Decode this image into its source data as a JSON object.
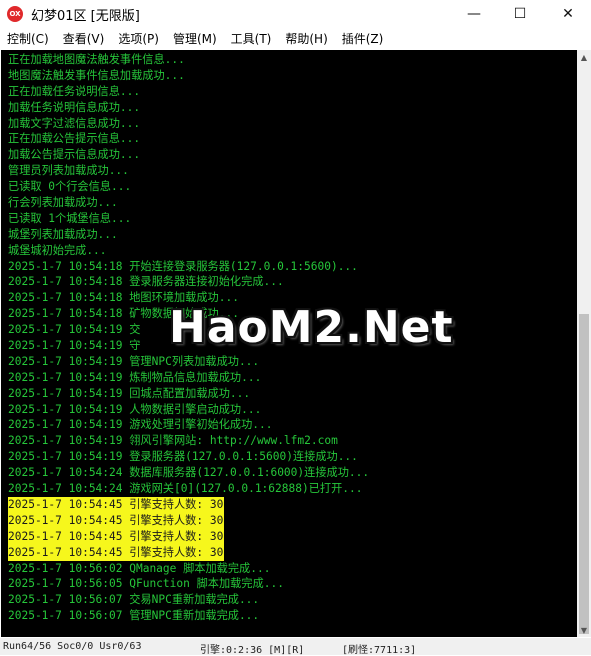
{
  "window": {
    "icon_text": "OX",
    "title": "幻梦01区 [无限版]",
    "controls": {
      "minimize": "—",
      "maximize": "☐",
      "close": "✕"
    }
  },
  "menu": [
    "控制(C)",
    "查看(V)",
    "选项(P)",
    "管理(M)",
    "工具(T)",
    "帮助(H)",
    "插件(Z)"
  ],
  "console": {
    "lines": [
      {
        "text": "正在加载地图魔法触发事件信息...",
        "highlight": false
      },
      {
        "text": "地图魔法触发事件信息加载成功...",
        "highlight": false
      },
      {
        "text": "正在加载任务说明信息...",
        "highlight": false
      },
      {
        "text": "加载任务说明信息成功...",
        "highlight": false
      },
      {
        "text": "加载文字过滤信息成功...",
        "highlight": false
      },
      {
        "text": "正在加载公告提示信息...",
        "highlight": false
      },
      {
        "text": "加载公告提示信息成功...",
        "highlight": false
      },
      {
        "text": "管理员列表加载成功...",
        "highlight": false
      },
      {
        "text": "已读取 0个行会信息...",
        "highlight": false
      },
      {
        "text": "行会列表加载成功...",
        "highlight": false
      },
      {
        "text": "已读取 1个城堡信息...",
        "highlight": false
      },
      {
        "text": "城堡列表加载成功...",
        "highlight": false
      },
      {
        "text": "城堡城初始完成...",
        "highlight": false
      },
      {
        "text": "2025-1-7 10:54:18 开始连接登录服务器(127.0.0.1:5600)...",
        "highlight": false
      },
      {
        "text": "2025-1-7 10:54:18 登录服务器连接初始化完成...",
        "highlight": false
      },
      {
        "text": "2025-1-7 10:54:18 地图环境加载成功...",
        "highlight": false
      },
      {
        "text": "2025-1-7 10:54:18 矿物数据初始成功...",
        "highlight": false
      },
      {
        "text": "2025-1-7 10:54:19 交",
        "highlight": false
      },
      {
        "text": "2025-1-7 10:54:19 守",
        "highlight": false
      },
      {
        "text": "2025-1-7 10:54:19 管理NPC列表加载成功...",
        "highlight": false
      },
      {
        "text": "2025-1-7 10:54:19 炼制物品信息加载成功...",
        "highlight": false
      },
      {
        "text": "2025-1-7 10:54:19 回城点配置加载成功...",
        "highlight": false
      },
      {
        "text": "2025-1-7 10:54:19 人物数据引擎启动成功...",
        "highlight": false
      },
      {
        "text": "2025-1-7 10:54:19 游戏处理引擎初始化成功...",
        "highlight": false
      },
      {
        "text": "2025-1-7 10:54:19 翎风引擎网站: http://www.lfm2.com",
        "highlight": false
      },
      {
        "text": "2025-1-7 10:54:19 登录服务器(127.0.0.1:5600)连接成功...",
        "highlight": false
      },
      {
        "text": "2025-1-7 10:54:24 数据库服务器(127.0.0.1:6000)连接成功...",
        "highlight": false
      },
      {
        "text": "2025-1-7 10:54:24 游戏网关[0](127.0.0.1:62888)已打开...",
        "highlight": false
      },
      {
        "text": "2025-1-7 10:54:45 引擎支持人数: 30",
        "highlight": true
      },
      {
        "text": "2025-1-7 10:54:45 引擎支持人数: 30",
        "highlight": true
      },
      {
        "text": "2025-1-7 10:54:45 引擎支持人数: 30",
        "highlight": true
      },
      {
        "text": "2025-1-7 10:54:45 引擎支持人数: 30",
        "highlight": true
      },
      {
        "text": "2025-1-7 10:56:02 QManage 脚本加载完成...",
        "highlight": false
      },
      {
        "text": "2025-1-7 10:56:05 QFunction 脚本加载完成...",
        "highlight": false
      },
      {
        "text": "2025-1-7 10:56:07 交易NPC重新加载完成...",
        "highlight": false
      },
      {
        "text": "2025-1-7 10:56:07 管理NPC重新加载完成...",
        "highlight": false
      }
    ]
  },
  "watermark": "HaoM2.Net",
  "statusbar": {
    "left": "Run64/56 Soc0/0 Usr0/63",
    "engine": "引擎:0:2:36 [M][R]",
    "version": "[刷怪:7711:3]"
  }
}
